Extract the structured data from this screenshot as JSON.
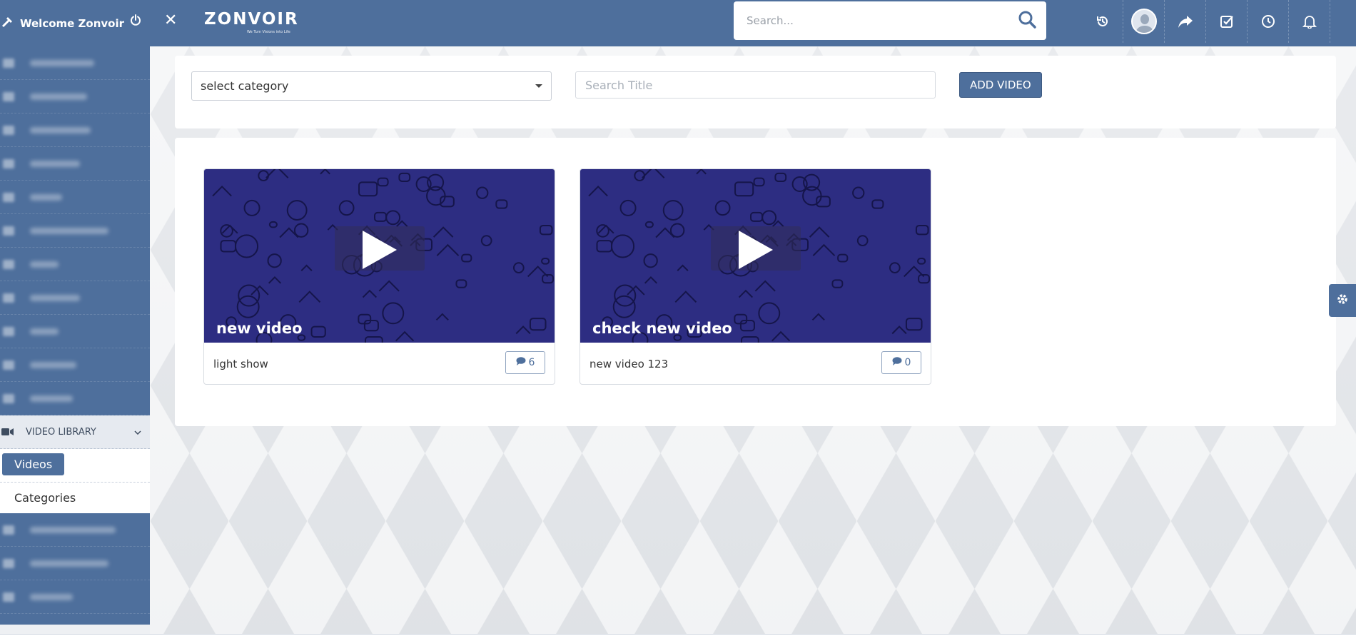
{
  "header": {
    "welcome_text": "Welcome Zonvoir",
    "logo_text": "ZONVOIR",
    "logo_tagline": "We Turn Visions into Life",
    "search_placeholder": "Search..."
  },
  "sidebar": {
    "section_label": "VIDEO LIBRARY",
    "sub_items": [
      {
        "label": "Videos",
        "active": true
      },
      {
        "label": "Categories",
        "active": false
      }
    ]
  },
  "filters": {
    "category_select_value": "select category",
    "title_placeholder": "Search Title",
    "add_button_label": "ADD VIDEO"
  },
  "videos": [
    {
      "thumb_title": "new video",
      "name": "light show",
      "comments": "6"
    },
    {
      "thumb_title": "check new video",
      "name": "new video 123",
      "comments": "0"
    }
  ],
  "colors": {
    "primary": "#4e6f9c",
    "thumb_bg": "#2d2d82"
  },
  "icons": [
    "hammer-icon",
    "power-icon",
    "close-icon",
    "search-icon",
    "history-icon",
    "share-icon",
    "checkbox-icon",
    "clock-icon",
    "bell-icon",
    "video-camera-icon",
    "chevron-down-icon",
    "comment-icon",
    "gear-icon",
    "play-icon"
  ]
}
